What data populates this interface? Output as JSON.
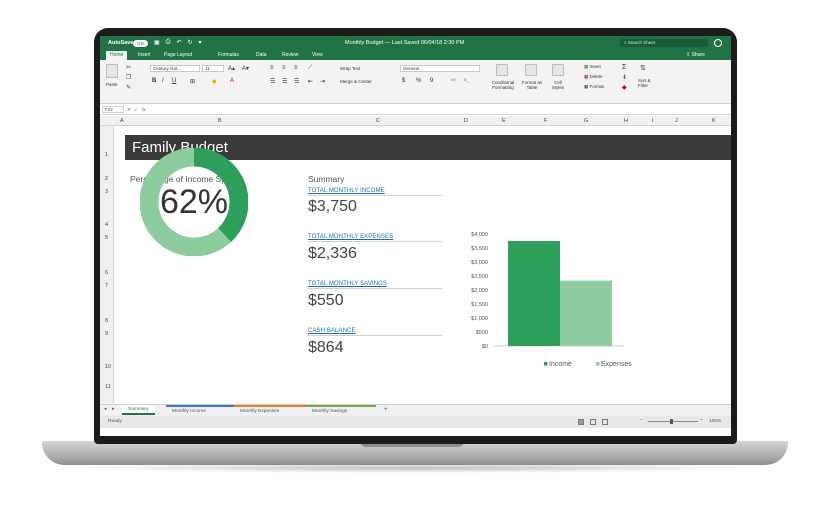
{
  "window": {
    "autosave_label": "AutoSave",
    "autosave_state": "ON",
    "doc_title": "Monthly Budget — Last Saved 06/04/18 2:30 PM",
    "search_placeholder": "Search Sheet"
  },
  "tabs": [
    "Home",
    "Insert",
    "Page Layout",
    "Formulas",
    "Data",
    "Review",
    "View"
  ],
  "share_label": "Share",
  "ribbon": {
    "paste_label": "Paste",
    "font_name": "Century Got...",
    "font_size": "11",
    "wrap_text": "Wrap Text",
    "merge_center": "Merge & Center",
    "number_format": "General",
    "currency": "$",
    "percent": "%",
    "comma": "9",
    "conditional_formatting": "Conditional Formatting",
    "format_as_table": "Format as Table",
    "cell_styles": "Cell Styles",
    "insert": "Insert",
    "delete": "Delete",
    "format": "Format",
    "sort_filter": "Sort & Filter"
  },
  "formula_bar": {
    "name_box": "F22",
    "fx": "fx"
  },
  "columns": [
    "A",
    "B",
    "C",
    "D",
    "E",
    "F",
    "G",
    "H",
    "I",
    "J",
    "K"
  ],
  "rows": [
    "1",
    "2",
    "3",
    "4",
    "5",
    "6",
    "7",
    "8",
    "9",
    "10",
    "11"
  ],
  "sheet": {
    "title": "Family Budget",
    "percentage_label": "Percentage of Income Spent",
    "percentage_value": "62%",
    "percentage_fraction": 0.62,
    "summary_label": "Summary",
    "summary": [
      {
        "label": "TOTAL MONTHLY INCOME",
        "value": "$3,750"
      },
      {
        "label": "TOTAL MONTHLY EXPENSES",
        "value": "$2,336"
      },
      {
        "label": "TOTAL MONTHLY SAVINGS",
        "value": "$550"
      },
      {
        "label": "CASH BALANCE",
        "value": "$864"
      }
    ]
  },
  "chart_data": {
    "type": "bar",
    "categories": [
      ""
    ],
    "series": [
      {
        "name": "Income",
        "values": [
          3750
        ],
        "color": "#2e9e5b"
      },
      {
        "name": "Expenses",
        "values": [
          2336
        ],
        "color": "#8ccc9f"
      }
    ],
    "y_ticks": [
      "$4,000",
      "$3,500",
      "$3,000",
      "$2,500",
      "$2,000",
      "$1,500",
      "$1,000",
      "$500",
      "$0"
    ],
    "ylim": [
      0,
      4000
    ],
    "grid": false,
    "legend": "bottom"
  },
  "sheet_tabs": [
    "Summary",
    "Monthly Income",
    "Monthly Expenses",
    "Monthly Savings"
  ],
  "status": {
    "ready": "Ready",
    "zoom": "100%"
  },
  "colors": {
    "excel_green": "#217346",
    "donut_dark": "#2e9e5b",
    "donut_light": "#8ccc9f"
  }
}
